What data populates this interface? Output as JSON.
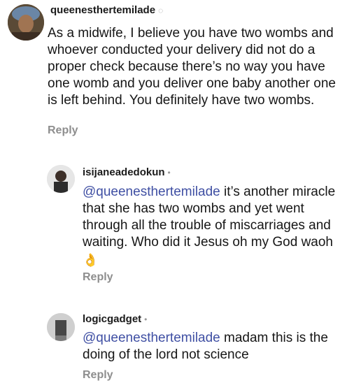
{
  "comments": [
    {
      "username": "queenesthertemilade",
      "text": "As a midwife, I believe you have two wombs and whoever conducted your delivery did not do a proper check because there’s no way you have one womb and you deliver one baby another one is left behind. You definitely have two wombs.",
      "reply_label": "Reply"
    },
    {
      "username": "isijaneadedokun",
      "mention": "@queenesthertemilade",
      "text": " it’s another miracle that she has two wombs and yet went through all the trouble of miscarriages and waiting.  Who did it Jesus oh my God waoh",
      "emoji": "👌",
      "reply_label": "Reply"
    },
    {
      "username": "logicgadget",
      "mention": "@queenesthertemilade",
      "text": " madam this is the doing of the lord not science",
      "reply_label": "Reply"
    }
  ],
  "colors": {
    "mention": "#3f4fa3",
    "reply": "#8e8e8e",
    "text": "#161616"
  }
}
